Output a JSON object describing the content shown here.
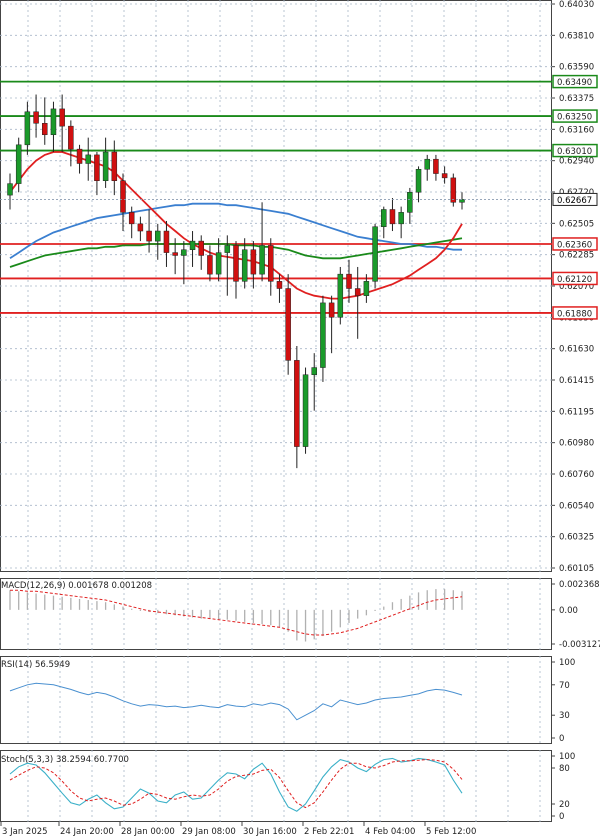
{
  "colors": {
    "grid": "#a9b6c8",
    "axis": "#444444",
    "bull": "#1a9a2a",
    "bear": "#d01010",
    "wick": "#222222",
    "ma_fast": "#e02020",
    "ma_mid": "#1a8a1a",
    "ma_slow": "#3a7fd0",
    "support": "#e02020",
    "resistance": "#1a8a1a",
    "macd_hist": "#b0b0b0",
    "macd_signal": "#e02020",
    "rsi": "#4a90d0",
    "stoch_main": "#3ab0c8",
    "stoch_signal": "#e02020",
    "price_tag_bg": "#ffffff"
  },
  "chart_data": [
    {
      "type": "candlestick",
      "pair_label": "",
      "ylim": [
        0.60105,
        0.6403
      ],
      "y_ticks": [
        "0.64030",
        "0.63810",
        "0.63590",
        "0.63375",
        "0.63160",
        "0.62940",
        "0.62720",
        "0.62505",
        "0.62285",
        "0.62070",
        "0.61850",
        "0.61630",
        "0.61415",
        "0.61195",
        "0.60980",
        "0.60760",
        "0.60540",
        "0.60325",
        "0.60105"
      ],
      "x_labels": [
        "3 Jan 2025",
        "24 Jan 20:00",
        "28 Jan 00:00",
        "29 Jan 08:00",
        "30 Jan 16:00",
        "2 Feb 22:01",
        "4 Feb 04:00",
        "5 Feb 12:00"
      ],
      "current_price": "0.62667",
      "horizontal_levels": [
        {
          "value": 0.6349,
          "label": "0.63490",
          "kind": "resistance"
        },
        {
          "value": 0.6325,
          "label": "0.63250",
          "kind": "resistance"
        },
        {
          "value": 0.6301,
          "label": "0.63010",
          "kind": "resistance"
        },
        {
          "value": 0.6236,
          "label": "0.62360",
          "kind": "support"
        },
        {
          "value": 0.6212,
          "label": "0.62120",
          "kind": "support"
        },
        {
          "value": 0.6188,
          "label": "0.61880",
          "kind": "support"
        }
      ],
      "candles": [
        [
          0.627,
          0.6285,
          0.626,
          0.6278
        ],
        [
          0.6278,
          0.631,
          0.6272,
          0.6305
        ],
        [
          0.6305,
          0.6335,
          0.6298,
          0.6328
        ],
        [
          0.6328,
          0.634,
          0.631,
          0.632
        ],
        [
          0.632,
          0.6338,
          0.6305,
          0.6312
        ],
        [
          0.6312,
          0.6335,
          0.63,
          0.633
        ],
        [
          0.633,
          0.634,
          0.63,
          0.6318
        ],
        [
          0.6318,
          0.6322,
          0.629,
          0.6302
        ],
        [
          0.6302,
          0.6305,
          0.6285,
          0.6292
        ],
        [
          0.6292,
          0.631,
          0.628,
          0.6298
        ],
        [
          0.6298,
          0.63,
          0.627,
          0.628
        ],
        [
          0.628,
          0.631,
          0.6275,
          0.63
        ],
        [
          0.63,
          0.6308,
          0.627,
          0.628
        ],
        [
          0.628,
          0.6285,
          0.6245,
          0.6258
        ],
        [
          0.6258,
          0.6262,
          0.624,
          0.625
        ],
        [
          0.625,
          0.6255,
          0.6238,
          0.6245
        ],
        [
          0.6245,
          0.626,
          0.623,
          0.6238
        ],
        [
          0.6238,
          0.625,
          0.6225,
          0.6245
        ],
        [
          0.6245,
          0.6252,
          0.622,
          0.623
        ],
        [
          0.623,
          0.624,
          0.6215,
          0.6228
        ],
        [
          0.6228,
          0.6238,
          0.6208,
          0.6232
        ],
        [
          0.6232,
          0.6245,
          0.622,
          0.6238
        ],
        [
          0.6238,
          0.6242,
          0.6218,
          0.6228
        ],
        [
          0.6228,
          0.6235,
          0.621,
          0.6215
        ],
        [
          0.6215,
          0.624,
          0.621,
          0.623
        ],
        [
          0.623,
          0.6242,
          0.62,
          0.6235
        ],
        [
          0.6235,
          0.6238,
          0.6198,
          0.621
        ],
        [
          0.621,
          0.624,
          0.6205,
          0.6232
        ],
        [
          0.6232,
          0.6238,
          0.6205,
          0.6215
        ],
        [
          0.6215,
          0.6265,
          0.621,
          0.6235
        ],
        [
          0.6235,
          0.624,
          0.62,
          0.621
        ],
        [
          0.621,
          0.6215,
          0.6195,
          0.6205
        ],
        [
          0.6205,
          0.6215,
          0.6145,
          0.6155
        ],
        [
          0.6155,
          0.6165,
          0.608,
          0.6095
        ],
        [
          0.6095,
          0.615,
          0.609,
          0.6145
        ],
        [
          0.6145,
          0.616,
          0.612,
          0.615
        ],
        [
          0.615,
          0.62,
          0.614,
          0.6195
        ],
        [
          0.6195,
          0.62,
          0.616,
          0.6185
        ],
        [
          0.6185,
          0.622,
          0.618,
          0.6215
        ],
        [
          0.6215,
          0.6225,
          0.6195,
          0.6205
        ],
        [
          0.6205,
          0.622,
          0.617,
          0.62
        ],
        [
          0.62,
          0.6215,
          0.6195,
          0.621
        ],
        [
          0.621,
          0.625,
          0.6205,
          0.6248
        ],
        [
          0.6248,
          0.6262,
          0.624,
          0.626
        ],
        [
          0.626,
          0.6268,
          0.6245,
          0.625
        ],
        [
          0.625,
          0.6262,
          0.624,
          0.6258
        ],
        [
          0.6258,
          0.6275,
          0.625,
          0.6272
        ],
        [
          0.6272,
          0.629,
          0.6265,
          0.6288
        ],
        [
          0.6288,
          0.6298,
          0.628,
          0.6295
        ],
        [
          0.6295,
          0.6298,
          0.628,
          0.6285
        ],
        [
          0.6285,
          0.629,
          0.6278,
          0.6282
        ],
        [
          0.6282,
          0.6285,
          0.6262,
          0.6265
        ],
        [
          0.6265,
          0.6272,
          0.626,
          0.6267
        ]
      ],
      "ma_fast": [
        0.6272,
        0.628,
        0.6288,
        0.6294,
        0.6298,
        0.63,
        0.63,
        0.6298,
        0.6296,
        0.6294,
        0.6292,
        0.629,
        0.6286,
        0.628,
        0.6274,
        0.6268,
        0.6262,
        0.6256,
        0.625,
        0.6245,
        0.624,
        0.6236,
        0.6233,
        0.623,
        0.6228,
        0.6227,
        0.6226,
        0.6225,
        0.6224,
        0.6222,
        0.622,
        0.6215,
        0.621,
        0.6205,
        0.6202,
        0.62,
        0.6199,
        0.6198,
        0.6198,
        0.6199,
        0.62,
        0.6202,
        0.6204,
        0.6206,
        0.6208,
        0.6211,
        0.6214,
        0.6218,
        0.6222,
        0.6226,
        0.6232,
        0.624,
        0.625
      ],
      "ma_mid": [
        0.622,
        0.6222,
        0.6224,
        0.6226,
        0.6228,
        0.6229,
        0.623,
        0.6231,
        0.6232,
        0.6233,
        0.6233,
        0.6234,
        0.6234,
        0.6235,
        0.6235,
        0.6235,
        0.6236,
        0.6236,
        0.6236,
        0.6236,
        0.6236,
        0.6236,
        0.6236,
        0.6236,
        0.6236,
        0.6236,
        0.6235,
        0.6235,
        0.6235,
        0.6234,
        0.6234,
        0.6233,
        0.6232,
        0.623,
        0.6228,
        0.6227,
        0.6226,
        0.6226,
        0.6226,
        0.6227,
        0.6228,
        0.6229,
        0.623,
        0.6231,
        0.6232,
        0.6233,
        0.6234,
        0.6235,
        0.6236,
        0.6237,
        0.6238,
        0.6239,
        0.624
      ],
      "ma_slow": [
        0.6226,
        0.623,
        0.6234,
        0.6238,
        0.6241,
        0.6244,
        0.6246,
        0.6248,
        0.625,
        0.6252,
        0.6254,
        0.6255,
        0.6256,
        0.6257,
        0.6258,
        0.6259,
        0.626,
        0.6261,
        0.6262,
        0.6263,
        0.6263,
        0.6264,
        0.6264,
        0.6264,
        0.6264,
        0.6263,
        0.6263,
        0.6262,
        0.6261,
        0.626,
        0.6259,
        0.6258,
        0.6257,
        0.6255,
        0.6253,
        0.6251,
        0.6249,
        0.6247,
        0.6245,
        0.6243,
        0.6241,
        0.624,
        0.6239,
        0.6238,
        0.6237,
        0.6236,
        0.6236,
        0.6235,
        0.6234,
        0.6234,
        0.6233,
        0.6232,
        0.6232
      ]
    },
    {
      "type": "bar",
      "label": "MACD(12,26,9) 0.001678 0.001208",
      "y_ticks": [
        "0.002368",
        "0.00",
        "-0.003127"
      ],
      "ylim": [
        -0.003127,
        0.002368
      ],
      "histogram": [
        0.0018,
        0.0017,
        0.0016,
        0.0015,
        0.0014,
        0.0013,
        0.0012,
        0.0011,
        0.001,
        0.0009,
        0.0008,
        0.0007,
        0.0005,
        0.0003,
        0.0001,
        -0.0001,
        -0.0002,
        -0.0003,
        -0.0004,
        -0.0005,
        -0.0006,
        -0.0007,
        -0.0008,
        -0.0008,
        -0.0009,
        -0.0009,
        -0.001,
        -0.0011,
        -0.0012,
        -0.0013,
        -0.0014,
        -0.0016,
        -0.002,
        -0.0028,
        -0.0029,
        -0.0027,
        -0.0024,
        -0.002,
        -0.0016,
        -0.0012,
        -0.0008,
        -0.0005,
        -0.0001,
        0.0003,
        0.0007,
        0.001,
        0.0013,
        0.0016,
        0.0018,
        0.0019,
        0.0019,
        0.0018,
        0.0017
      ],
      "signal": [
        0.0018,
        0.0018,
        0.0017,
        0.0017,
        0.0016,
        0.0015,
        0.0014,
        0.0013,
        0.0012,
        0.0011,
        0.001,
        0.0009,
        0.0007,
        0.0005,
        0.0003,
        0.0001,
        -0.0001,
        -0.0002,
        -0.0003,
        -0.0004,
        -0.0005,
        -0.0006,
        -0.0007,
        -0.0008,
        -0.0009,
        -0.001,
        -0.0011,
        -0.0012,
        -0.0013,
        -0.0014,
        -0.0015,
        -0.0016,
        -0.0018,
        -0.002,
        -0.0022,
        -0.0023,
        -0.0023,
        -0.0022,
        -0.0021,
        -0.0019,
        -0.0017,
        -0.0014,
        -0.0011,
        -0.0008,
        -0.0005,
        -0.0002,
        0.0001,
        0.0004,
        0.0007,
        0.0009,
        0.001,
        0.0011,
        0.0012
      ]
    },
    {
      "type": "line",
      "label": "RSI(14) 56.5949",
      "y_ticks": [
        "100",
        "70",
        "30",
        "0"
      ],
      "ylim": [
        0,
        100
      ],
      "values": [
        62,
        66,
        70,
        72,
        71,
        70,
        67,
        64,
        60,
        57,
        60,
        58,
        54,
        49,
        45,
        42,
        44,
        43,
        41,
        42,
        40,
        41,
        43,
        41,
        40,
        44,
        42,
        41,
        45,
        43,
        46,
        44,
        38,
        24,
        30,
        36,
        45,
        41,
        50,
        47,
        44,
        46,
        50,
        52,
        53,
        54,
        56,
        58,
        62,
        64,
        63,
        60,
        56.6
      ]
    },
    {
      "type": "line",
      "label": "Stoch(5,3,3) 38.2594 60.7700",
      "y_ticks": [
        "100",
        "80",
        "20",
        "0"
      ],
      "ylim": [
        0,
        100
      ],
      "main": [
        70,
        82,
        88,
        85,
        72,
        55,
        38,
        22,
        18,
        28,
        35,
        22,
        12,
        15,
        30,
        45,
        38,
        25,
        22,
        35,
        40,
        28,
        30,
        45,
        60,
        72,
        70,
        62,
        78,
        88,
        70,
        40,
        15,
        8,
        20,
        42,
        65,
        82,
        94,
        90,
        80,
        74,
        86,
        94,
        96,
        90,
        92,
        96,
        94,
        90,
        85,
        60,
        38
      ],
      "signal": [
        60,
        68,
        76,
        82,
        80,
        72,
        58,
        42,
        30,
        25,
        28,
        30,
        25,
        18,
        20,
        28,
        38,
        36,
        30,
        28,
        32,
        35,
        33,
        35,
        45,
        58,
        66,
        68,
        70,
        76,
        78,
        64,
        42,
        22,
        14,
        22,
        40,
        60,
        78,
        88,
        88,
        82,
        80,
        84,
        90,
        92,
        92,
        93,
        94,
        93,
        90,
        78,
        61
      ]
    }
  ]
}
